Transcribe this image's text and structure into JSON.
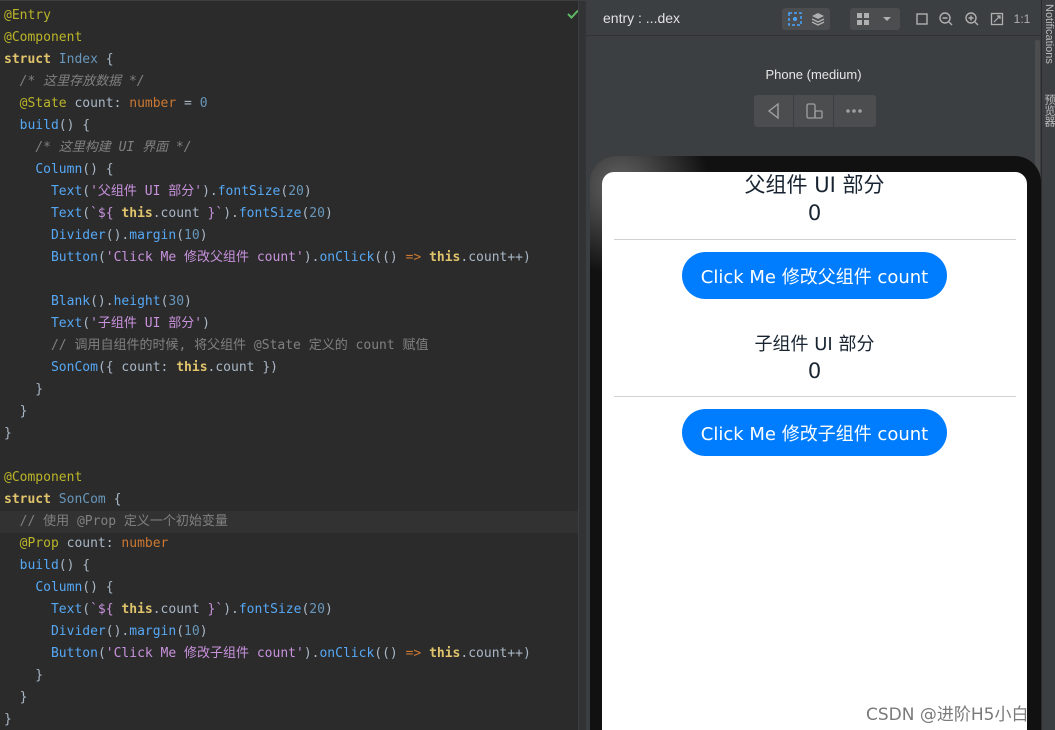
{
  "editor": {
    "lines": [
      [
        [
          "ann",
          "@Entry"
        ]
      ],
      [
        [
          "ann",
          "@Component"
        ]
      ],
      [
        [
          "kwb",
          "struct"
        ],
        [
          "t",
          " "
        ],
        [
          "typ",
          "Index"
        ],
        [
          "t",
          " {"
        ]
      ],
      [
        [
          "t",
          "  "
        ],
        [
          "cmi",
          "/* 这里存放数据 */"
        ]
      ],
      [
        [
          "t",
          "  "
        ],
        [
          "ann",
          "@State"
        ],
        [
          "t",
          " count: "
        ],
        [
          "kw",
          "number"
        ],
        [
          "t",
          " = "
        ],
        [
          "num",
          "0"
        ]
      ],
      [
        [
          "t",
          "  "
        ],
        [
          "fn",
          "build"
        ],
        [
          "t",
          "() {"
        ]
      ],
      [
        [
          "t",
          "    "
        ],
        [
          "cmi",
          "/* 这里构建 UI 界面 */"
        ]
      ],
      [
        [
          "t",
          "    "
        ],
        [
          "fn",
          "Column"
        ],
        [
          "t",
          "() {"
        ]
      ],
      [
        [
          "t",
          "      "
        ],
        [
          "fn",
          "Text"
        ],
        [
          "t",
          "("
        ],
        [
          "str",
          "'父组件 UI 部分'"
        ],
        [
          "t",
          ")."
        ],
        [
          "fn",
          "fontSize"
        ],
        [
          "t",
          "("
        ],
        [
          "num",
          "20"
        ],
        [
          "t",
          ")"
        ]
      ],
      [
        [
          "t",
          "      "
        ],
        [
          "fn",
          "Text"
        ],
        [
          "t",
          "("
        ],
        [
          "str",
          "`${"
        ],
        [
          "kwb",
          " this"
        ],
        [
          "t",
          ".count "
        ],
        [
          "str",
          "}`"
        ],
        [
          "t",
          ")."
        ],
        [
          "fn",
          "fontSize"
        ],
        [
          "t",
          "("
        ],
        [
          "num",
          "20"
        ],
        [
          "t",
          ")"
        ]
      ],
      [
        [
          "t",
          "      "
        ],
        [
          "fn",
          "Divider"
        ],
        [
          "t",
          "()."
        ],
        [
          "fn",
          "margin"
        ],
        [
          "t",
          "("
        ],
        [
          "num",
          "10"
        ],
        [
          "t",
          ")"
        ]
      ],
      [
        [
          "t",
          "      "
        ],
        [
          "fn",
          "Button"
        ],
        [
          "t",
          "("
        ],
        [
          "str",
          "'Click Me 修改父组件 count'"
        ],
        [
          "t",
          ")."
        ],
        [
          "fn",
          "onClick"
        ],
        [
          "t",
          "(() "
        ],
        [
          "kw",
          "=>"
        ],
        [
          "kwb",
          " this"
        ],
        [
          "t",
          ".count++)"
        ]
      ],
      [
        [
          "t",
          ""
        ]
      ],
      [
        [
          "t",
          "      "
        ],
        [
          "fn",
          "Blank"
        ],
        [
          "t",
          "()."
        ],
        [
          "fn",
          "height"
        ],
        [
          "t",
          "("
        ],
        [
          "num",
          "30"
        ],
        [
          "t",
          ")"
        ]
      ],
      [
        [
          "t",
          "      "
        ],
        [
          "fn",
          "Text"
        ],
        [
          "t",
          "("
        ],
        [
          "str",
          "'子组件 UI 部分'"
        ],
        [
          "t",
          ")"
        ]
      ],
      [
        [
          "t",
          "      "
        ],
        [
          "cm",
          "// 调用自组件的时候, 将父组件 @State 定义的 count 赋值"
        ]
      ],
      [
        [
          "t",
          "      "
        ],
        [
          "fn",
          "SonCom"
        ],
        [
          "t",
          "({ count: "
        ],
        [
          "kwb",
          "this"
        ],
        [
          "t",
          ".count })"
        ]
      ],
      [
        [
          "t",
          "    }"
        ]
      ],
      [
        [
          "t",
          "  }"
        ]
      ],
      [
        [
          "t",
          "}"
        ]
      ],
      [
        [
          "t",
          ""
        ]
      ],
      [
        [
          "ann",
          "@Component"
        ]
      ],
      [
        [
          "kwb",
          "struct"
        ],
        [
          "t",
          " "
        ],
        [
          "typ",
          "SonCom"
        ],
        [
          "t",
          " {"
        ]
      ],
      [
        [
          "t",
          "  "
        ],
        [
          "cm",
          "// 使用 @Prop 定义一个初始变量"
        ]
      ],
      [
        [
          "t",
          "  "
        ],
        [
          "ann",
          "@Prop"
        ],
        [
          "t",
          " count: "
        ],
        [
          "kw",
          "number"
        ]
      ],
      [
        [
          "t",
          "  "
        ],
        [
          "fn",
          "build"
        ],
        [
          "t",
          "() {"
        ]
      ],
      [
        [
          "t",
          "    "
        ],
        [
          "fn",
          "Column"
        ],
        [
          "t",
          "() {"
        ]
      ],
      [
        [
          "t",
          "      "
        ],
        [
          "fn",
          "Text"
        ],
        [
          "t",
          "("
        ],
        [
          "str",
          "`${"
        ],
        [
          "kwb",
          " this"
        ],
        [
          "t",
          ".count "
        ],
        [
          "str",
          "}`"
        ],
        [
          "t",
          ")."
        ],
        [
          "fn",
          "fontSize"
        ],
        [
          "t",
          "("
        ],
        [
          "num",
          "20"
        ],
        [
          "t",
          ")"
        ]
      ],
      [
        [
          "t",
          "      "
        ],
        [
          "fn",
          "Divider"
        ],
        [
          "t",
          "()."
        ],
        [
          "fn",
          "margin"
        ],
        [
          "t",
          "("
        ],
        [
          "num",
          "10"
        ],
        [
          "t",
          ")"
        ]
      ],
      [
        [
          "t",
          "      "
        ],
        [
          "fn",
          "Button"
        ],
        [
          "t",
          "("
        ],
        [
          "str",
          "'Click Me 修改子组件 count'"
        ],
        [
          "t",
          ")."
        ],
        [
          "fn",
          "onClick"
        ],
        [
          "t",
          "(() "
        ],
        [
          "kw",
          "=>"
        ],
        [
          "kwb",
          " this"
        ],
        [
          "t",
          ".count++)"
        ]
      ],
      [
        [
          "t",
          "    }"
        ]
      ],
      [
        [
          "t",
          "  }"
        ]
      ],
      [
        [
          "t",
          "}"
        ]
      ]
    ],
    "highlighted_line": 23
  },
  "previewer": {
    "title": "entry : ...dex",
    "device_name": "Phone (medium)",
    "app": {
      "parent_title": "父组件 UI 部分",
      "parent_count": "0",
      "parent_button": "Click Me 修改父组件 count",
      "child_title": "子组件 UI 部分",
      "child_count": "0",
      "child_button": "Click Me 修改子组件 count"
    }
  },
  "side_tabs": {
    "notifications": "Notifications",
    "previewer": "预览器"
  },
  "watermark": "CSDN @进阶H5小白",
  "colors": {
    "accent_button": "#007dff",
    "editor_bg": "#2b2b2b",
    "panel_bg": "#3c3f41"
  },
  "icons": {
    "inspector": "inspector-icon",
    "layers": "layers-icon",
    "grid": "grid-icon",
    "back": "back-triangle-icon",
    "rotate": "rotate-device-icon",
    "more": "more-icon"
  }
}
